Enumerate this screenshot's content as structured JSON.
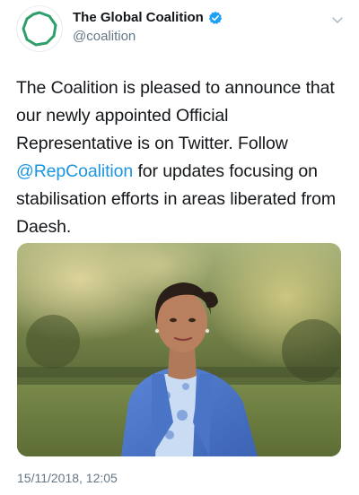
{
  "account": {
    "display_name": "The Global Coalition",
    "handle": "@coalition",
    "verified": true,
    "avatar_icon": "coalition-logo-icon",
    "accent_color": "#2e9e6b"
  },
  "tweet": {
    "text_before": "The Coalition is pleased to announce that our newly appointed Official Representative is on Twitter. Follow ",
    "mention": "@RepCoalition",
    "text_after": " for updates focusing on stabilisation efforts in areas liberated from Daesh.",
    "mention_color": "#1b95e0"
  },
  "media": {
    "type": "photo",
    "icon": "photo-portrait"
  },
  "meta": {
    "timestamp": "15/11/2018, 12:05"
  },
  "menu": {
    "icon": "chevron-down-icon"
  }
}
